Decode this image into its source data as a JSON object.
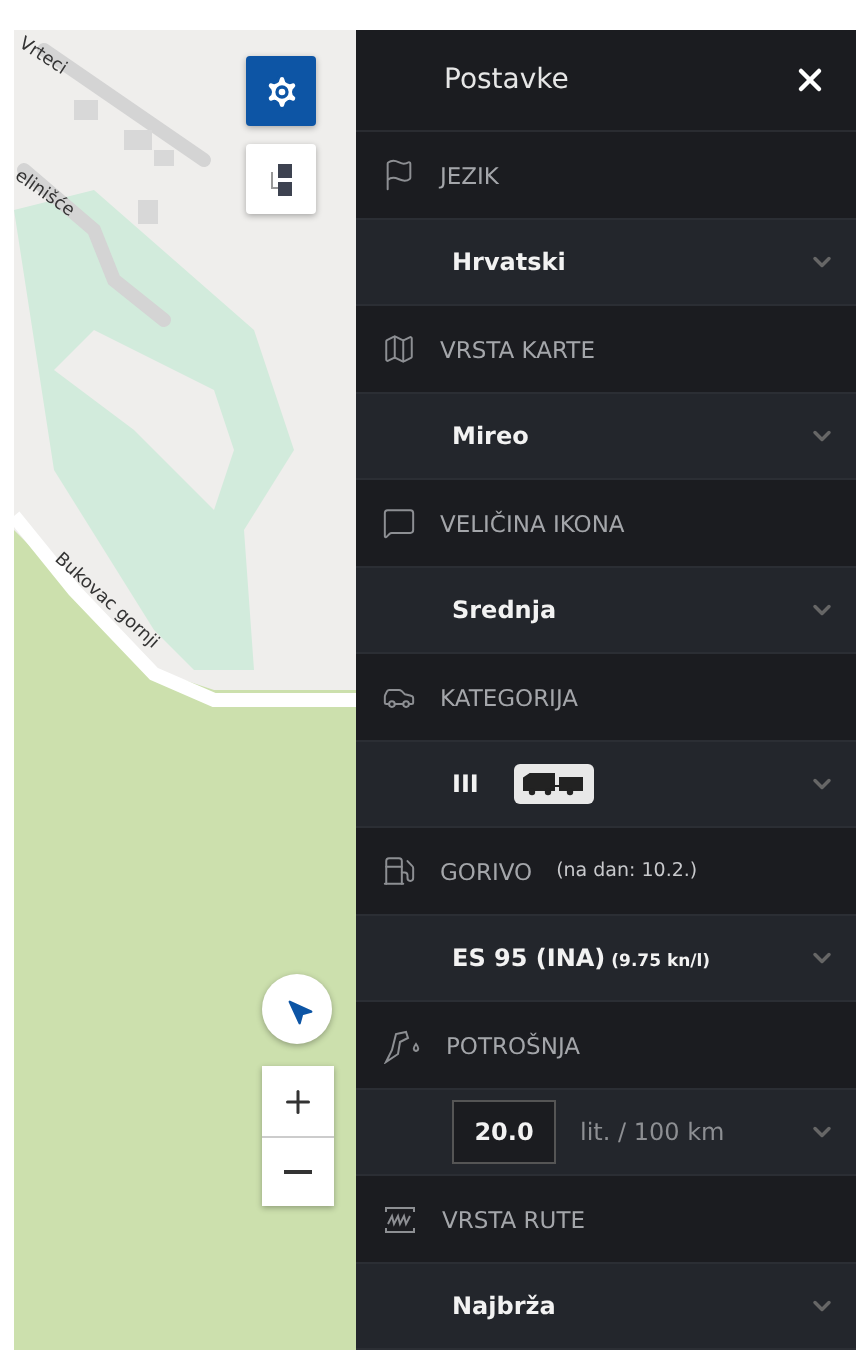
{
  "map": {
    "street_labels": [
      "Vrteci",
      "elinišće",
      "Bukovac gornji"
    ]
  },
  "panel": {
    "title": "Postavke",
    "sections": [
      {
        "label": "JEZIK",
        "value": {
          "kind": "select",
          "text": "Hrvatski"
        }
      },
      {
        "label": "VRSTA KARTE",
        "value": {
          "kind": "select",
          "text": "Mireo"
        }
      },
      {
        "label": "VELIČINA IKONA",
        "value": {
          "kind": "select",
          "text": "Srednja"
        }
      },
      {
        "label": "KATEGORIJA",
        "value": {
          "kind": "category",
          "text": "III"
        }
      },
      {
        "label": "GORIVO",
        "note": "(na dan: 10.2.)",
        "value": {
          "kind": "select",
          "text": "ES 95 (INA)",
          "small": "(9.75 kn/l)"
        }
      },
      {
        "label": "POTROŠNJA",
        "value": {
          "kind": "input",
          "text": "20.0",
          "unit": "lit. / 100 km"
        }
      },
      {
        "label": "VRSTA RUTE",
        "value": {
          "kind": "select",
          "text": "Najbrža"
        }
      }
    ]
  }
}
